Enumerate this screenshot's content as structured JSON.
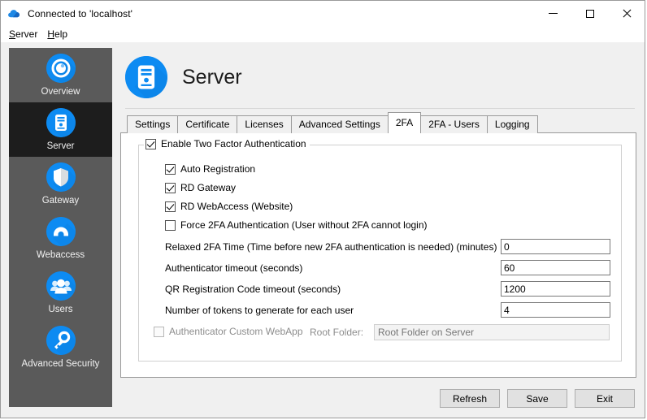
{
  "window": {
    "title": "Connected to 'localhost'",
    "title_icon": "cloud-icon",
    "minimize": "–",
    "maximize": "□",
    "close": "×"
  },
  "menubar": {
    "items": [
      {
        "label": "Server",
        "accel": "S"
      },
      {
        "label": "Help",
        "accel": "H"
      }
    ]
  },
  "sidebar": {
    "items": [
      {
        "label": "Overview",
        "icon": "overview-icon",
        "selected": false
      },
      {
        "label": "Server",
        "icon": "server-icon",
        "selected": true
      },
      {
        "label": "Gateway",
        "icon": "shield-icon",
        "selected": false
      },
      {
        "label": "Webaccess",
        "icon": "cloud-icon",
        "selected": false
      },
      {
        "label": "Users",
        "icon": "users-icon",
        "selected": false
      },
      {
        "label": "Advanced Security",
        "icon": "key-icon",
        "selected": false
      }
    ]
  },
  "page": {
    "title": "Server",
    "icon": "server-icon"
  },
  "tabs": [
    {
      "label": "Settings",
      "active": false
    },
    {
      "label": "Certificate",
      "active": false
    },
    {
      "label": "Licenses",
      "active": false
    },
    {
      "label": "Advanced Settings",
      "active": false
    },
    {
      "label": "2FA",
      "active": true
    },
    {
      "label": "2FA - Users",
      "active": false
    },
    {
      "label": "Logging",
      "active": false
    }
  ],
  "twofa": {
    "group_title": "Enable Two Factor Authentication",
    "group_checked": true,
    "checkboxes": [
      {
        "label": "Auto Registration",
        "checked": true,
        "enabled": true
      },
      {
        "label": "RD Gateway",
        "checked": true,
        "enabled": true
      },
      {
        "label": "RD WebAccess (Website)",
        "checked": true,
        "enabled": true
      },
      {
        "label": "Force 2FA Authentication (User without 2FA cannot login)",
        "checked": false,
        "enabled": true
      }
    ],
    "fields": [
      {
        "label": "Relaxed 2FA Time (Time before new 2FA authentication is needed) (minutes)",
        "value": "0"
      },
      {
        "label": "Authenticator timeout (seconds)",
        "value": "60"
      },
      {
        "label": "QR Registration Code timeout (seconds)",
        "value": "1200"
      },
      {
        "label": "Number of tokens to generate for each user",
        "value": "4"
      }
    ],
    "webapp": {
      "checkbox_label": "Authenticator Custom WebApp",
      "checked": false,
      "enabled": false,
      "root_folder_label": "Root Folder:",
      "root_folder_placeholder": "Root Folder on Server",
      "root_folder_value": ""
    }
  },
  "buttons": {
    "refresh": "Refresh",
    "save": "Save",
    "exit": "Exit"
  },
  "colors": {
    "accent": "#0d8bf2",
    "sidebar_bg": "#5a5a5a",
    "sidebar_selected": "#1d1d1d",
    "window_bg": "#f0f0f0"
  }
}
